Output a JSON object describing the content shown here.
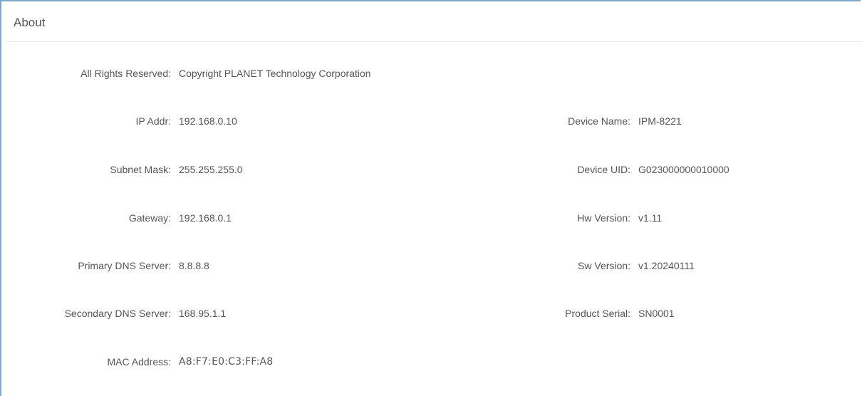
{
  "header": {
    "title": "About"
  },
  "fields": {
    "rights": {
      "label": "All Rights Reserved:",
      "value": "Copyright PLANET Technology Corporation"
    },
    "ip": {
      "label": "IP Addr:",
      "value": "192.168.0.10"
    },
    "subnet": {
      "label": "Subnet Mask:",
      "value": "255.255.255.0"
    },
    "gateway": {
      "label": "Gateway:",
      "value": "192.168.0.1"
    },
    "primary_dns": {
      "label": "Primary DNS Server:",
      "value": "8.8.8.8"
    },
    "secondary_dns": {
      "label": "Secondary DNS Server:",
      "value": "168.95.1.1"
    },
    "mac": {
      "label": "MAC Address:",
      "value": "A8:F7:E0:C3:FF:A8"
    },
    "device_name": {
      "label": "Device Name:",
      "value": "IPM-8221"
    },
    "device_uid": {
      "label": "Device UID:",
      "value": "G023000000010000"
    },
    "hw_version": {
      "label": "Hw Version:",
      "value": "v1.11"
    },
    "sw_version": {
      "label": "Sw Version:",
      "value": "v1.20240111"
    },
    "product_serial": {
      "label": "Product Serial:",
      "value": "SN0001"
    }
  }
}
